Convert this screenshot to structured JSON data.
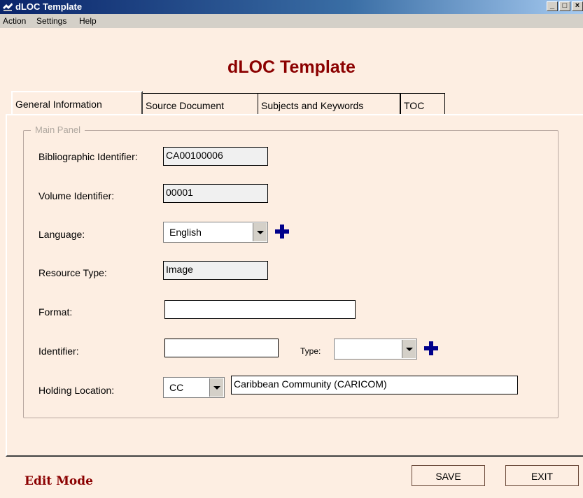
{
  "window": {
    "title": "dLOC Template",
    "controls": [
      "_",
      "□",
      "×"
    ]
  },
  "menu": [
    "Action",
    "Settings",
    "Help"
  ],
  "app_title": "dLOC Template",
  "tabs": [
    {
      "label": "General Information",
      "active": true
    },
    {
      "label": "Source Document",
      "active": false
    },
    {
      "label": "Subjects and Keywords",
      "active": false
    },
    {
      "label": "TOC",
      "active": false
    }
  ],
  "panel": {
    "legend": "Main Panel",
    "fields": {
      "bib_id": {
        "label": "Bibliographic Identifier:",
        "value": "CA00100006"
      },
      "vol_id": {
        "label": "Volume Identifier:",
        "value": "00001"
      },
      "language": {
        "label": "Language:",
        "value": "English"
      },
      "resource_type": {
        "label": "Resource Type:",
        "value": "Image"
      },
      "format": {
        "label": "Format:",
        "value": ""
      },
      "identifier": {
        "label": "Identifier:",
        "value": "",
        "type_label": "Type:",
        "type_value": ""
      },
      "holding": {
        "label": "Holding Location:",
        "code": "CC",
        "name": "Caribbean Community (CARICOM)"
      }
    }
  },
  "footer": {
    "mode": "Edit Mode",
    "save": "SAVE",
    "exit": "EXIT"
  },
  "colors": {
    "background": "#fdeee2",
    "title_red": "#8b0000",
    "plus_blue": "#00008b"
  }
}
